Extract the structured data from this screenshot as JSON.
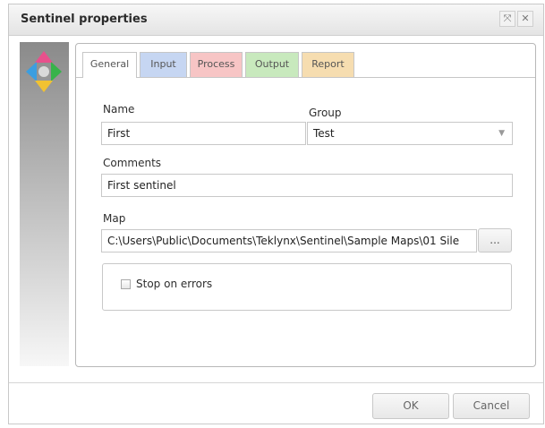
{
  "window": {
    "title": "Sentinel properties",
    "maximize_icon": "⤧",
    "close_icon": "✕"
  },
  "tabs": [
    {
      "label": "General",
      "color": "#ffffff"
    },
    {
      "label": "Input",
      "color": "#c6d6f2"
    },
    {
      "label": "Process",
      "color": "#f7c5c5"
    },
    {
      "label": "Output",
      "color": "#c8e9bd"
    },
    {
      "label": "Report",
      "color": "#f6ddb0"
    }
  ],
  "form": {
    "name_label": "Name",
    "name_value": "First",
    "group_label": "Group",
    "group_value": "Test",
    "comments_label": "Comments",
    "comments_value": "First sentinel",
    "map_label": "Map",
    "map_value": "C:\\Users\\Public\\Documents\\Teklynx\\Sentinel\\Sample Maps\\01 Sile",
    "browse_label": "...",
    "stop_on_errors_label": "Stop on errors",
    "stop_on_errors_checked": false
  },
  "buttons": {
    "ok": "OK",
    "cancel": "Cancel"
  }
}
